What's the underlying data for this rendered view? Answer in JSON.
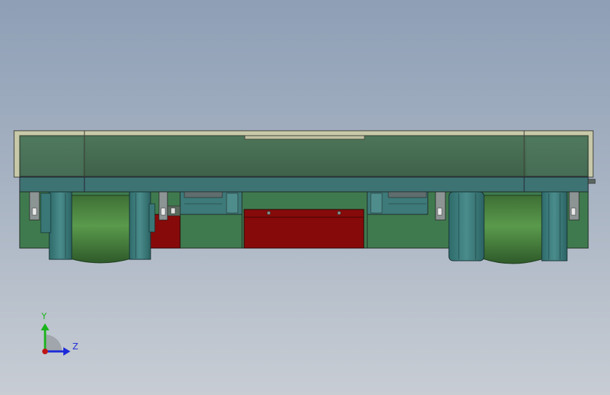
{
  "viewport": {
    "background_top": "#8e9fb6",
    "background_bottom": "#c8cdd4"
  },
  "model": {
    "frame_color": "#c8c9a9",
    "body_color": "#4a6f55",
    "wheel_green": "#4c8440",
    "hub_teal": "#3b7d7d",
    "box_red": "#870a0a"
  },
  "triad": {
    "y_label": "Y",
    "z_label": "Z",
    "y_color": "#19b319",
    "z_color": "#1c2ad9",
    "x_color": "#c01515"
  }
}
